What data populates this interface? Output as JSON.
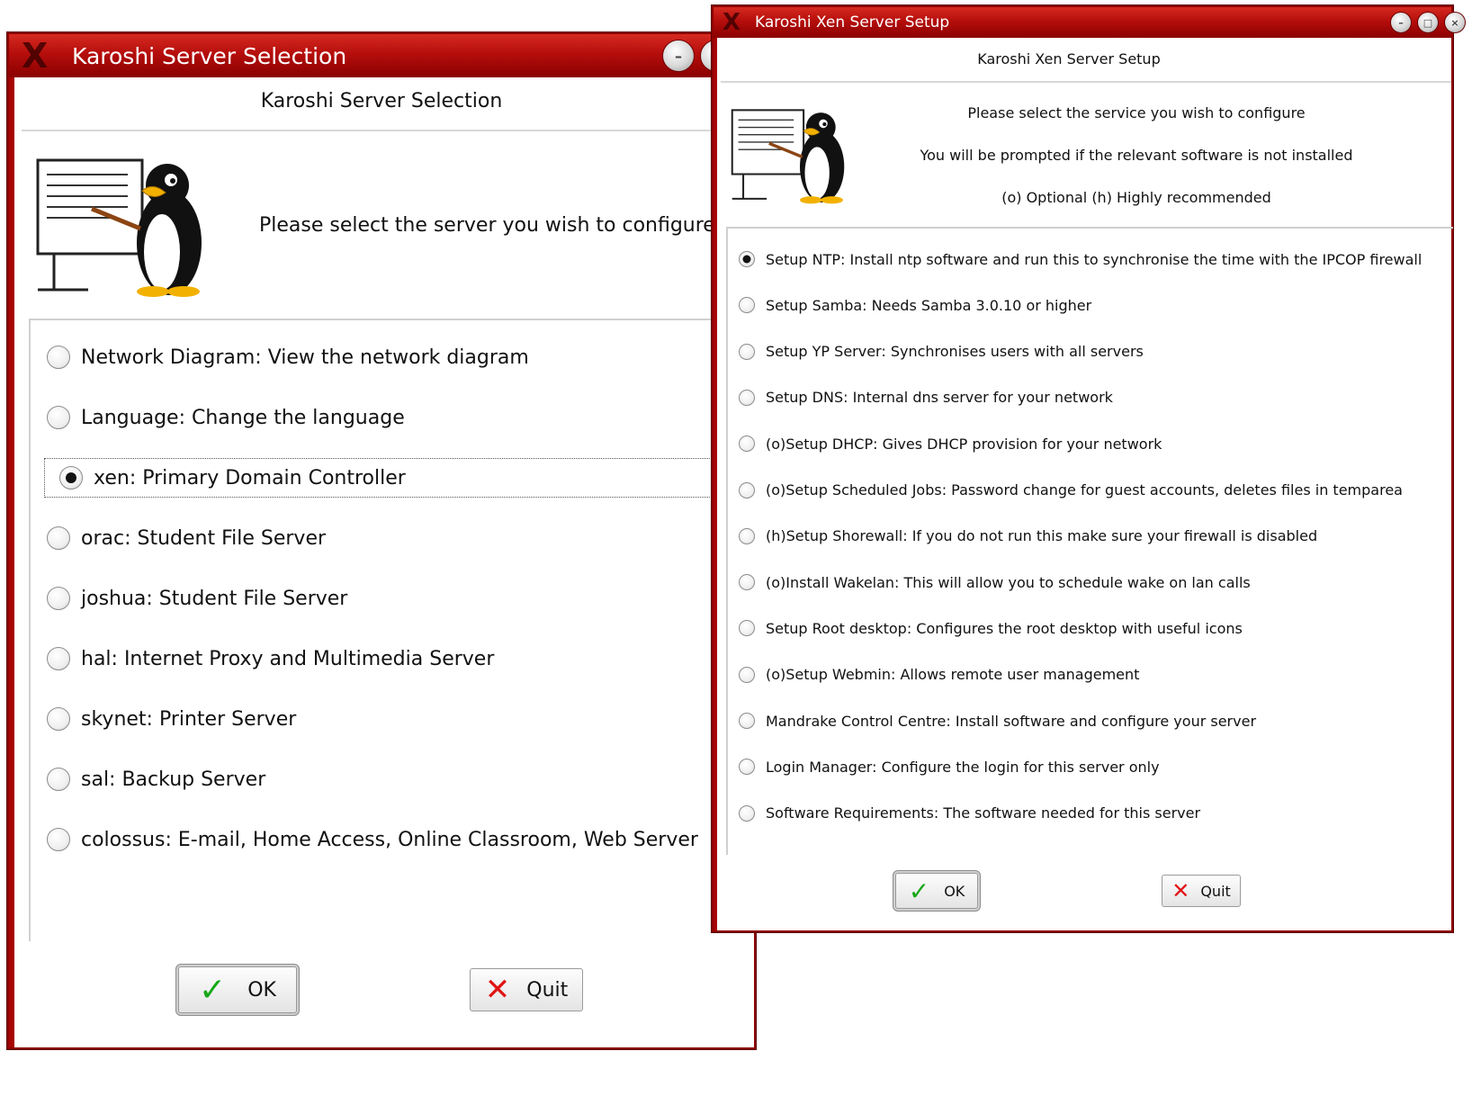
{
  "left_window": {
    "title": "Karoshi Server Selection",
    "heading": "Karoshi Server Selection",
    "prompt": "Please select the server you wish to configure",
    "options": [
      {
        "label": "Network Diagram: View the network diagram",
        "checked": false
      },
      {
        "label": "Language: Change the language",
        "checked": false
      },
      {
        "label": "xen: Primary Domain Controller",
        "checked": true
      },
      {
        "label": "orac: Student File Server",
        "checked": false
      },
      {
        "label": "joshua: Student File Server",
        "checked": false
      },
      {
        "label": "hal: Internet Proxy and Multimedia Server",
        "checked": false
      },
      {
        "label": "skynet: Printer Server",
        "checked": false
      },
      {
        "label": "sal: Backup Server",
        "checked": false
      },
      {
        "label": "colossus: E-mail, Home Access, Online Classroom, Web Server",
        "checked": false
      }
    ],
    "ok_label": "OK",
    "quit_label": "Quit"
  },
  "right_window": {
    "title": "Karoshi Xen Server Setup",
    "heading": "Karoshi Xen Server Setup",
    "prompt_lines": [
      "Please select the service you wish to configure",
      "You will be prompted if the relevant software is not installed",
      "(o) Optional (h) Highly recommended"
    ],
    "options": [
      {
        "label": "Setup NTP: Install ntp software and run this to synchronise the time with the IPCOP firewall",
        "checked": true
      },
      {
        "label": "Setup Samba: Needs Samba 3.0.10 or higher",
        "checked": false
      },
      {
        "label": "Setup YP Server: Synchronises users with all servers",
        "checked": false
      },
      {
        "label": "Setup DNS: Internal dns server for your network",
        "checked": false
      },
      {
        "label": "(o)Setup DHCP: Gives DHCP provision for your network",
        "checked": false
      },
      {
        "label": "(o)Setup Scheduled Jobs: Password change for guest accounts, deletes files in temparea",
        "checked": false
      },
      {
        "label": "(h)Setup Shorewall: If you do not run this make sure your firewall is disabled",
        "checked": false
      },
      {
        "label": "(o)Install Wakelan: This will allow you to schedule wake on lan calls",
        "checked": false
      },
      {
        "label": "Setup Root desktop: Configures the root desktop with useful icons",
        "checked": false
      },
      {
        "label": "(o)Setup Webmin: Allows remote user management",
        "checked": false
      },
      {
        "label": "Mandrake Control Centre: Install software and configure your server",
        "checked": false
      },
      {
        "label": "Login Manager: Configure the login for this server only",
        "checked": false
      },
      {
        "label": "Software Requirements: The software needed for this server",
        "checked": false
      }
    ],
    "ok_label": "OK",
    "quit_label": "Quit"
  },
  "icons": {
    "window_menu": "x-logo-icon",
    "minimize": "minimize-icon",
    "maximize": "maximize-icon",
    "close": "close-icon",
    "ok": "checkmark-icon",
    "quit": "red-x-icon",
    "mascot": "penguin-presenter-icon"
  },
  "colors": {
    "titlebar": "#b50e0c",
    "frame": "#8e0000",
    "ok_check": "#16a816",
    "quit_x": "#e01515"
  }
}
